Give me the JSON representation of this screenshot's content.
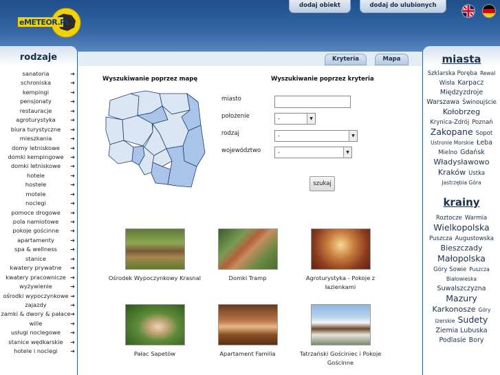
{
  "header": {
    "logo_text": "eMETEOR.PL",
    "buttons": [
      "dodaj obiekt",
      "dodaj do ulubionych"
    ],
    "flags": [
      "english-flag",
      "german-flag"
    ]
  },
  "left": {
    "title": "rodzaje",
    "items": [
      "sanatoria",
      "schroniska",
      "kempingi",
      "pensjonaty",
      "restauracje",
      "agroturystyka",
      "biura turystyczne",
      "mieszkania",
      "domy letniskowe",
      "domki kempingowe",
      "domki letniskowe",
      "hotele",
      "hostele",
      "motele",
      "noclegi",
      "pomoce drogowe",
      "pola namiotowe",
      "pokoje gościnne",
      "apartamenty",
      "spa & wellness",
      "stanice",
      "kwatery prywatne",
      "kwatery pracownicze",
      "wyżywienie",
      "ośrodki wypoczynkowe",
      "zajazdy",
      "zamki & dwory & pałace",
      "wille",
      "usługi noclegowe",
      "stanice wędkarskie",
      "hotele i noclegi"
    ]
  },
  "tabs": [
    "Kryteria",
    "Mapa"
  ],
  "map_section": {
    "title": "Wyszukiwanie poprzez mapę"
  },
  "criteria": {
    "title": "Wyszukiwanie poprzez kryteria",
    "fields": {
      "miasto": "miasto",
      "polozenie": "położenie",
      "rodzaj": "rodzaj",
      "wojewodztwo": "województwo"
    },
    "select_default": "-",
    "search_label": "szukaj"
  },
  "listings": [
    {
      "name": "Ośrodek Wypoczynkowy Krasnal",
      "photo": "forest-cabins-photo"
    },
    {
      "name": "Domki Tramp",
      "photo": "a-frame-cabin-photo"
    },
    {
      "name": "Agroturystyka - Pokoje z łazienkami",
      "photo": "dining-room-photo"
    },
    {
      "name": "Pałac Sapetów",
      "photo": "palace-aerial-photo"
    },
    {
      "name": "Apartament Familia",
      "photo": "bedroom-photo"
    },
    {
      "name": "Tatrzański Gościniec i Pokoje Gościnne",
      "photo": "mountain-house-photo"
    }
  ],
  "right": {
    "miasta_title": "miasta",
    "miasta": [
      {
        "t": "Szklarska Poręba",
        "s": 2
      },
      {
        "t": "Rewal",
        "s": 1
      },
      {
        "t": "Wisła",
        "s": 2
      },
      {
        "t": "Karpacz",
        "s": 3
      },
      {
        "t": "Międzyzdroje",
        "s": 3
      },
      {
        "t": "Warszawa",
        "s": 3
      },
      {
        "t": "Świnoujście",
        "s": 2
      },
      {
        "t": "Kołobrzeg",
        "s": 4
      },
      {
        "t": "Krynica-Zdrój",
        "s": 2
      },
      {
        "t": "Poznań",
        "s": 2
      },
      {
        "t": "Zakopane",
        "s": 5
      },
      {
        "t": "Sopot",
        "s": 2
      },
      {
        "t": "Ustronie Morskie",
        "s": 1
      },
      {
        "t": "Łeba",
        "s": 3
      },
      {
        "t": "Mielno",
        "s": 2
      },
      {
        "t": "Gdańsk",
        "s": 3
      },
      {
        "t": "Władysławowo",
        "s": 4
      },
      {
        "t": "Kraków",
        "s": 4
      },
      {
        "t": "Ustka",
        "s": 2
      },
      {
        "t": "Jastrzębia Góra",
        "s": 1
      }
    ],
    "krainy_title": "krainy",
    "krainy": [
      {
        "t": "Roztocze",
        "s": 2
      },
      {
        "t": "Warmia",
        "s": 2
      },
      {
        "t": "Wielkopolska",
        "s": 5
      },
      {
        "t": "Puszcza",
        "s": 2
      },
      {
        "t": "Augustowska",
        "s": 2
      },
      {
        "t": "Bieszczady",
        "s": 4
      },
      {
        "t": "Małopolska",
        "s": 5
      },
      {
        "t": "Góry Sowie",
        "s": 2
      },
      {
        "t": "Puszcza",
        "s": 1
      },
      {
        "t": "Białowieska",
        "s": 1
      },
      {
        "t": "Suwalszczyzna",
        "s": 3
      },
      {
        "t": "Mazury",
        "s": 5
      },
      {
        "t": "Karkonosze",
        "s": 4
      },
      {
        "t": "Góry",
        "s": 1
      },
      {
        "t": "Izerskie",
        "s": 1
      },
      {
        "t": "Sudety",
        "s": 5
      },
      {
        "t": "Ziemia Lubuska",
        "s": 3
      },
      {
        "t": "Podlasie",
        "s": 3
      },
      {
        "t": "Bory",
        "s": 3
      }
    ]
  },
  "colors": {
    "header": "#2f5d94",
    "map_fill": "#dbe6f4",
    "map_highlight": "#a9c4e8"
  }
}
